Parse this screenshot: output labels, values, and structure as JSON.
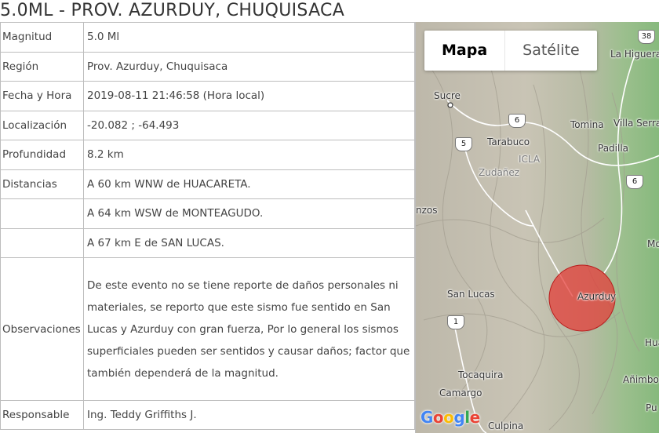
{
  "title": "5.0ML - PROV. AZURDUY, CHUQUISACA",
  "details": {
    "magnitud": {
      "label": "Magnitud",
      "value": "5.0 Ml"
    },
    "region": {
      "label": "Región",
      "value": "Prov. Azurduy, Chuquisaca"
    },
    "fecha": {
      "label": "Fecha y Hora",
      "value": "2019-08-11 21:46:58 (Hora local)"
    },
    "localizacion": {
      "label": "Localización",
      "value": "-20.082 ; -64.493"
    },
    "profundidad": {
      "label": "Profundidad",
      "value": "8.2 km"
    },
    "distancias": {
      "label": "Distancias",
      "values": [
        "A 60 km WNW de HUACARETA.",
        "A 64 km WSW de MONTEAGUDO.",
        "A 67 km E de SAN LUCAS."
      ]
    },
    "observaciones": {
      "label": "Observaciones",
      "value": "De este evento no se tiene reporte de daños personales ni materiales, se reporto que este sismo fue sentido en San Lucas y Azurduy con gran fuerza, Por lo general los sismos superficiales pueden ser sentidos y causar daños; factor que también dependerá de la magnitud."
    },
    "responsable": {
      "label": "Responsable",
      "value": "Ing. Teddy Griffiths J."
    }
  },
  "map": {
    "type_control": {
      "map_label": "Mapa",
      "satellite_label": "Satélite",
      "selected": "map"
    },
    "places": {
      "sucre": "Sucre",
      "la_higuera": "La Higuera",
      "tomina": "Tomina",
      "villa_serrano": "Villa Serra",
      "tarabuco": "Tarabuco",
      "padilla": "Padilla",
      "icla": "ICLA",
      "zudanez": "Zudañez",
      "ravelo_partial": "nzos",
      "san_lucas": "San Lucas",
      "azurduy": "Azurduy",
      "tocaquira": "Tocaquira",
      "camargo": "Camargo",
      "culpina": "Culpina",
      "animbo": "Añimbo",
      "monte_partial": "Mo",
      "hua_partial": "Hua",
      "pu_partial": "Pu"
    },
    "routes": {
      "r38": "38",
      "r6a": "6",
      "r5": "5",
      "r6b": "6",
      "r1": "1"
    },
    "logo": {
      "g1": "G",
      "o1": "o",
      "o2": "o",
      "g2": "g",
      "l": "l",
      "e": "e"
    },
    "epicenter_color": "#e53935"
  }
}
